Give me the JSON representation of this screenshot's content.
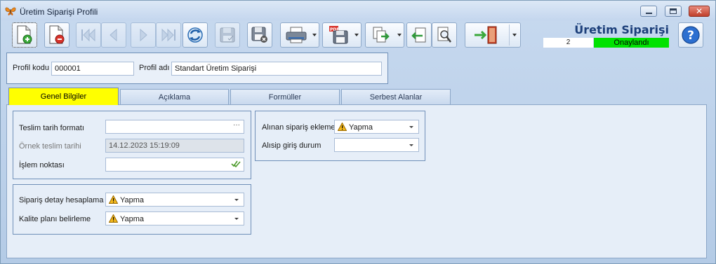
{
  "window": {
    "title": "Üretim Siparişi Profili"
  },
  "toolbar": {
    "icons": [
      "new-document-icon",
      "delete-document-icon",
      "first-record-icon",
      "previous-record-icon",
      "next-record-icon",
      "last-record-icon",
      "refresh-icon",
      "save-disabled-icon",
      "save-close-icon",
      "print-icon",
      "pdf-save-icon",
      "export-icon",
      "import-icon",
      "document-search-icon",
      "exit-door-icon"
    ]
  },
  "header": {
    "doc_title": "Üretim Siparişi Profili",
    "status_number": "2",
    "status_label": "Onaylandı",
    "status_color": "#00e200"
  },
  "profile": {
    "code_label": "Profil kodu",
    "code_value": "000001",
    "name_label": "Profil adı",
    "name_value": "Standart Üretim Siparişi"
  },
  "tabs": [
    {
      "label": "Genel Bilgiler",
      "active": true
    },
    {
      "label": "Açıklama",
      "active": false
    },
    {
      "label": "Formüller",
      "active": false
    },
    {
      "label": "Serbest Alanlar",
      "active": false
    }
  ],
  "general": {
    "delivery_format_label": "Teslim tarih formatı",
    "delivery_format_value": "",
    "sample_date_label": "Örnek teslim tarihi",
    "sample_date_value": "14.12.2023 15:19:09",
    "process_point_label": "İşlem noktası",
    "process_point_value": "",
    "order_detail_label": "Sipariş detay hesaplama",
    "order_detail_value": "Yapma",
    "quality_plan_label": "Kalite planı belirleme",
    "quality_plan_value": "Yapma",
    "received_order_label": "Alınan sipariş ekleme",
    "received_order_value": "Yapma",
    "purchase_entry_label": "Alısip giriş durum",
    "purchase_entry_value": ""
  },
  "colors": {
    "active_tab": "#ffff00",
    "title_blue": "#1c3f7a"
  }
}
